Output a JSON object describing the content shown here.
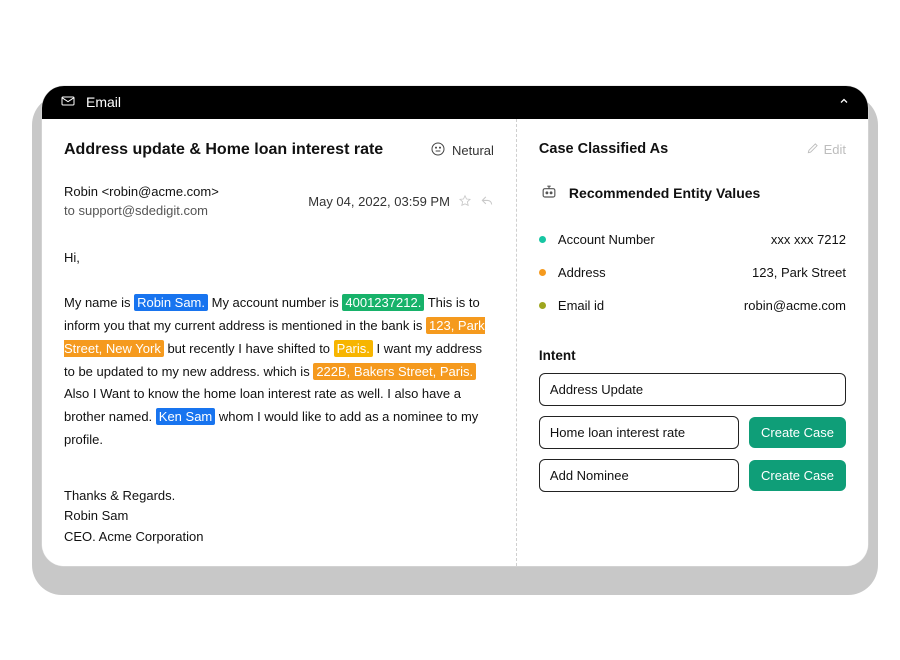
{
  "titlebar": {
    "label": "Email"
  },
  "email": {
    "subject": "Address update & Home loan interest rate",
    "sentiment": "Netural",
    "from": "Robin <robin@acme.com>",
    "to_prefix": "to ",
    "to": "support@sdedigit.com",
    "date": "May 04, 2022, 03:59 PM",
    "greeting": "Hi,",
    "body": {
      "t1": "My name is ",
      "h_name1": "Robin Sam.",
      "t2": " My account number is ",
      "h_account": "4001237212.",
      "t3": " This is to inform you that my current address is mentioned in the bank is ",
      "h_addr1": "123, Park Street, New York",
      "t4": " but recently I have shifted to ",
      "h_city": "Paris.",
      "t5": " I want my address to be updated to my new address. which is ",
      "h_addr2": "222B, Bakers Street, Paris.",
      "t6": " Also I Want to know the home loan interest rate as well. I also have a brother named. ",
      "h_name2": "Ken Sam",
      "t7": " whom I would like to add as a nominee to my profile."
    },
    "signoff": {
      "line1": "Thanks & Regards.",
      "line2": "Robin Sam",
      "line3": "CEO. Acme Corporation"
    }
  },
  "panel": {
    "title": "Case Classified As",
    "edit_label": "Edit",
    "recommended_title": "Recommended Entity Values",
    "entities": [
      {
        "label": "Account Number",
        "value": "xxx  xxx 7212"
      },
      {
        "label": "Address",
        "value": "123, Park Street"
      },
      {
        "label": "Email id",
        "value": "robin@acme.com"
      }
    ],
    "intent_title": "Intent",
    "intents": [
      {
        "label": "Address Update",
        "has_button": false
      },
      {
        "label": "Home loan interest rate",
        "has_button": true
      },
      {
        "label": "Add Nominee",
        "has_button": true
      }
    ],
    "create_case_label": "Create Case"
  }
}
